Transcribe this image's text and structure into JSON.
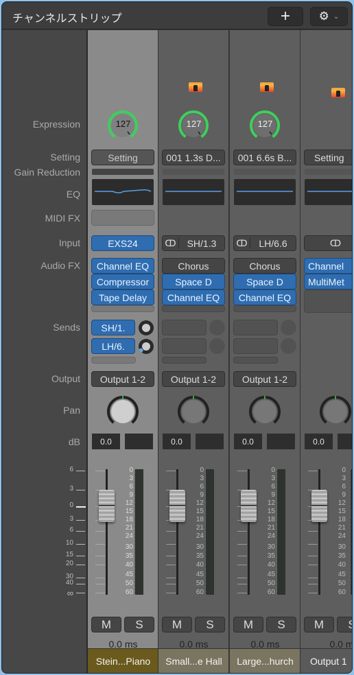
{
  "window": {
    "title": "チャンネルストリップ",
    "add_icon": "plus-icon",
    "settings_icon": "gear-icon",
    "settings_chevron": "chevron-down-icon"
  },
  "labels": {
    "expression": "Expression",
    "setting": "Setting",
    "gain_reduction": "Gain Reduction",
    "eq": "EQ",
    "midi_fx": "MIDI FX",
    "input": "Input",
    "audio_fx": "Audio FX",
    "sends": "Sends",
    "output": "Output",
    "pan": "Pan",
    "db": "dB"
  },
  "fader_scale": [
    "6",
    "3",
    "0",
    "3",
    "6",
    "10",
    "15",
    "20",
    "30",
    "40",
    "∞"
  ],
  "meter_scale": [
    "0",
    "3",
    "6",
    "9",
    "12",
    "15",
    "18",
    "21",
    "24",
    "30",
    "35",
    "40",
    "45",
    "50",
    "60"
  ],
  "colors": {
    "accent": "#2f6db0",
    "expression_ring": "#3ecf5c",
    "selected_strip": "#8a8a8a",
    "strip": "#5e5e5e"
  },
  "strips": [
    {
      "selected": true,
      "icon": null,
      "expression": "127",
      "setting": "Setting",
      "eq_curve": true,
      "midi_fx": true,
      "input": {
        "label": "EXS24",
        "link_icon": false,
        "plugin": true
      },
      "audio_fx": [
        {
          "label": "Channel EQ",
          "active": true
        },
        {
          "label": "Compressor",
          "active": true
        },
        {
          "label": "Tape Delay",
          "active": true
        }
      ],
      "sends": [
        {
          "label": "SH/1.",
          "level": 0
        },
        {
          "label": "LH/6.",
          "level": 0.1
        }
      ],
      "output": "Output 1-2",
      "pan": 0,
      "db": "0.0",
      "mute": "M",
      "solo": "S",
      "delay": "0.0 ms",
      "name": "Stein...Piano",
      "name_color": "#6b5a1d"
    },
    {
      "selected": false,
      "icon": "folder-icon",
      "expression": "127",
      "setting": "001 1.3s D...",
      "eq_curve": false,
      "midi_fx": false,
      "input": {
        "label": "SH/1.3",
        "link_icon": true,
        "plugin": false
      },
      "audio_fx": [
        {
          "label": "Chorus",
          "active": false
        },
        {
          "label": "Space D",
          "active": true
        },
        {
          "label": "Channel EQ",
          "active": true
        }
      ],
      "sends": [],
      "output": "Output 1-2",
      "pan": 0,
      "db": "0.0",
      "mute": "M",
      "solo": "S",
      "delay": "0.0 ms",
      "name": "Small...e Hall",
      "name_color": "#7a7560"
    },
    {
      "selected": false,
      "icon": "folder-icon",
      "expression": "127",
      "setting": "001 6.6s B...",
      "eq_curve": false,
      "midi_fx": false,
      "input": {
        "label": "LH/6.6",
        "link_icon": true,
        "plugin": false
      },
      "audio_fx": [
        {
          "label": "Chorus",
          "active": false
        },
        {
          "label": "Space D",
          "active": true
        },
        {
          "label": "Channel EQ",
          "active": true
        }
      ],
      "sends": [],
      "output": "Output 1-2",
      "pan": 0,
      "db": "0.0",
      "mute": "M",
      "solo": "S",
      "delay": "0.0 ms",
      "name": "Large...hurch",
      "name_color": "#7a7560"
    },
    {
      "selected": false,
      "icon": "folder-icon",
      "expression": null,
      "setting": "Setting",
      "eq_curve": false,
      "midi_fx": false,
      "input": {
        "label": "",
        "link_icon": true,
        "plugin": false
      },
      "audio_fx": [
        {
          "label": "Channel",
          "active": true
        },
        {
          "label": "MultiMet",
          "active": true
        }
      ],
      "sends": null,
      "output": null,
      "pan": 0,
      "db": "0.0",
      "mute": "M",
      "solo": "S",
      "delay": "0.0 ms",
      "name": "Output 1",
      "name_color": "#5a5a5a"
    }
  ]
}
